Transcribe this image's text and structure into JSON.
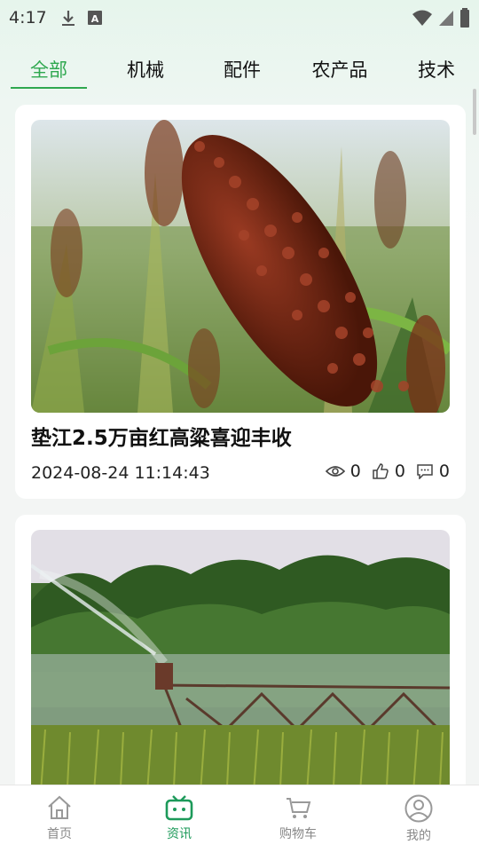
{
  "status_bar": {
    "time": "4:17",
    "icons": [
      "download-icon",
      "font-icon",
      "wifi-icon",
      "signal-icon",
      "battery-icon"
    ]
  },
  "tabs": [
    {
      "label": "全部",
      "active": true
    },
    {
      "label": "机械",
      "active": false
    },
    {
      "label": "配件",
      "active": false
    },
    {
      "label": "农产品",
      "active": false
    },
    {
      "label": "技术",
      "active": false
    }
  ],
  "feed": {
    "items": [
      {
        "image": "sorghum-photo",
        "title": "垫江2.5万亩红高粱喜迎丰收",
        "date": "2024-08-24 11:14:43",
        "views": "0",
        "likes": "0",
        "comments": "0"
      },
      {
        "image": "irrigation-photo"
      }
    ]
  },
  "bottom_nav": [
    {
      "label": "首页",
      "icon": "home-icon",
      "active": false
    },
    {
      "label": "资讯",
      "icon": "tv-icon",
      "active": true
    },
    {
      "label": "购物车",
      "icon": "cart-icon",
      "active": false
    },
    {
      "label": "我的",
      "icon": "user-icon",
      "active": false
    }
  ],
  "colors": {
    "accent": "#2fa84f",
    "nav_active": "#1d9a5a",
    "inactive": "#888888"
  }
}
